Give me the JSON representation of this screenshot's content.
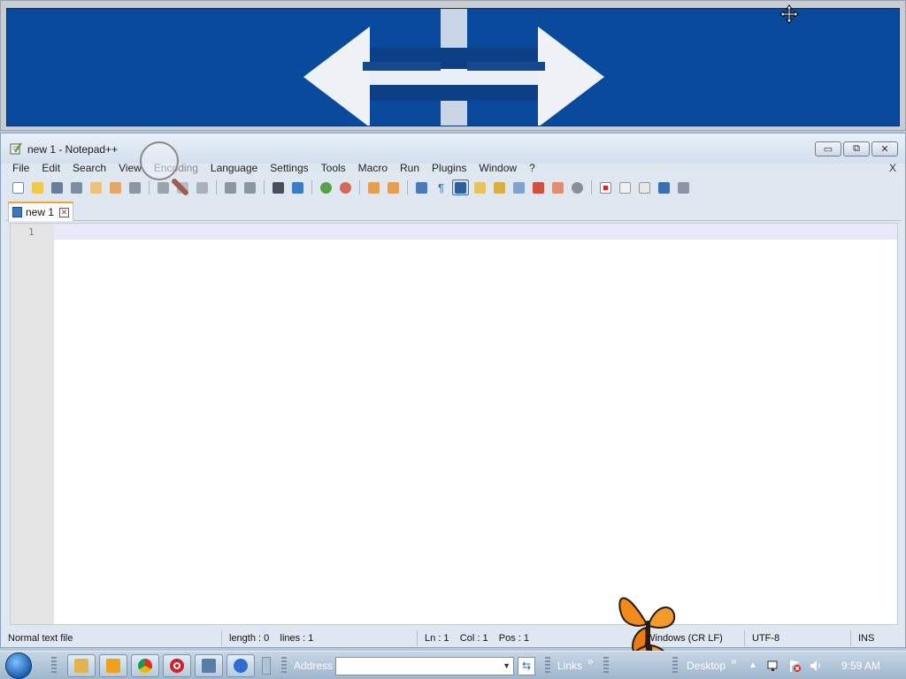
{
  "window": {
    "title": "new 1 - Notepad++",
    "minimize_icon": "minimize-icon",
    "restore_icon": "restore-icon",
    "close_icon": "close-icon"
  },
  "menu": {
    "items": [
      "File",
      "Edit",
      "Search",
      "View",
      "Encoding",
      "Language",
      "Settings",
      "Tools",
      "Macro",
      "Run",
      "Plugins",
      "Window",
      "?"
    ],
    "close_label": "X"
  },
  "toolbar": {
    "icons": [
      "new-file-icon",
      "open-file-icon",
      "save-icon",
      "save-all-icon",
      "close-icon",
      "close-all-icon",
      "print-icon",
      "cut-icon",
      "copy-icon",
      "paste-icon",
      "undo-icon",
      "redo-icon",
      "find-icon",
      "replace-icon",
      "zoom-in-icon",
      "zoom-out-icon",
      "sync-vertical-icon",
      "sync-horizontal-icon",
      "word-wrap-icon",
      "show-all-chars-icon",
      "indent-guide-icon",
      "lang-icon",
      "function-list-icon",
      "doc-map-icon",
      "folder-workspace-icon",
      "monitor-icon",
      "record-macro-icon",
      "stop-record-icon",
      "play-macro-icon",
      "run-macro-multiple-icon",
      "save-macro-icon"
    ]
  },
  "tab": {
    "label": "new 1"
  },
  "editor": {
    "line_number": "1"
  },
  "statusbar": {
    "file_type": "Normal text file",
    "length": "length : 0",
    "lines": "lines : 1",
    "ln": "Ln : 1",
    "col": "Col : 1",
    "pos": "Pos : 1",
    "eol": "Windows (CR LF)",
    "encoding": "UTF-8",
    "mode": "INS"
  },
  "taskbar": {
    "address_label": "Address",
    "address_value": "",
    "links_label": "Links",
    "desktop_label": "Desktop",
    "chevron": "»",
    "clock": "9:59 AM",
    "apps": [
      "explorer-icon",
      "media-player-icon",
      "chrome-icon",
      "opera-icon",
      "network-app-icon",
      "blue-app-icon"
    ]
  },
  "colors": {
    "magnifier_bg": "#0a4a9c",
    "active_tab_accent": "#f3a23a",
    "current_line": "#e8e8f8"
  }
}
